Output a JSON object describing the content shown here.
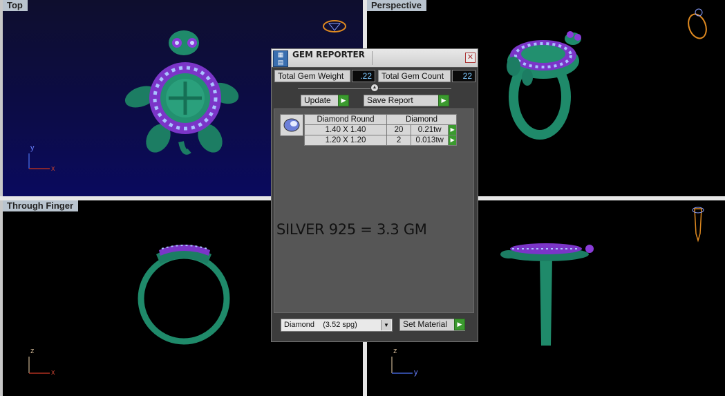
{
  "viewports": {
    "top": {
      "label": "Top",
      "axis_a": "y",
      "axis_b": "x"
    },
    "perspective": {
      "label": "Perspective"
    },
    "through_finger": {
      "label": "Through Finger",
      "axis_a": "z",
      "axis_b": "x"
    },
    "front": {
      "axis_a": "z",
      "axis_b": "y"
    }
  },
  "dialog": {
    "title": "GEM REPORTER",
    "close": "✕",
    "total_weight_label": "Total Gem Weight",
    "total_weight_value": ".22",
    "total_count_label": "Total Gem Count",
    "total_count_value": "22",
    "update_label": "Update",
    "save_report_label": "Save Report",
    "table": {
      "header_shape": "Diamond Round",
      "header_material": "Diamond",
      "rows": [
        {
          "size": "1.40 X 1.40",
          "count": "20",
          "weight": "0.21tw"
        },
        {
          "size": "1.20 X 1.20",
          "count": "2",
          "weight": "0.013tw"
        }
      ]
    },
    "note": "SILVER 925 = 3.3 GM",
    "material_select": "Diamond    (3.52 spg)",
    "set_material_label": "Set Material"
  },
  "colors": {
    "ring_green": "#1f8a6a",
    "gem_purple": "#8a3cd8",
    "gem_blue": "#9ab6ff",
    "axis_red": "#b03020",
    "axis_blue": "#4060d0"
  }
}
